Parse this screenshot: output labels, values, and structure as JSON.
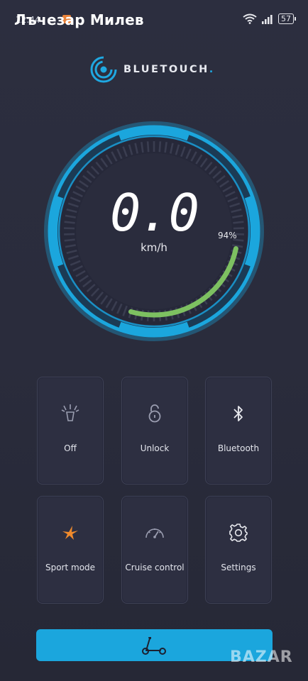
{
  "status_bar": {
    "time": "12:44",
    "overlay_name": "Лъчезар Милев",
    "battery": "57"
  },
  "brand": {
    "name": "BLUETOUCH",
    "dot": ".",
    "accent_color": "#1fa8e1"
  },
  "speedometer": {
    "speed": "0.0",
    "unit": "km/h",
    "battery_percent_label": "94%",
    "battery_level": 0.94,
    "arc_color": "#7dc061",
    "ring_color": "#1ba6dd"
  },
  "controls": [
    {
      "icon": "light-icon",
      "label": "Off"
    },
    {
      "icon": "lock-icon",
      "label": "Unlock"
    },
    {
      "icon": "bluetooth-icon",
      "label": "Bluetooth"
    },
    {
      "icon": "sport-icon",
      "label": "Sport mode"
    },
    {
      "icon": "speedometer-icon",
      "label": "Cruise control"
    },
    {
      "icon": "settings-icon",
      "label": "Settings"
    }
  ],
  "bottom_bar": {
    "icon": "scooter-icon",
    "color": "#1ba6dd"
  },
  "watermark": "BAZAR"
}
